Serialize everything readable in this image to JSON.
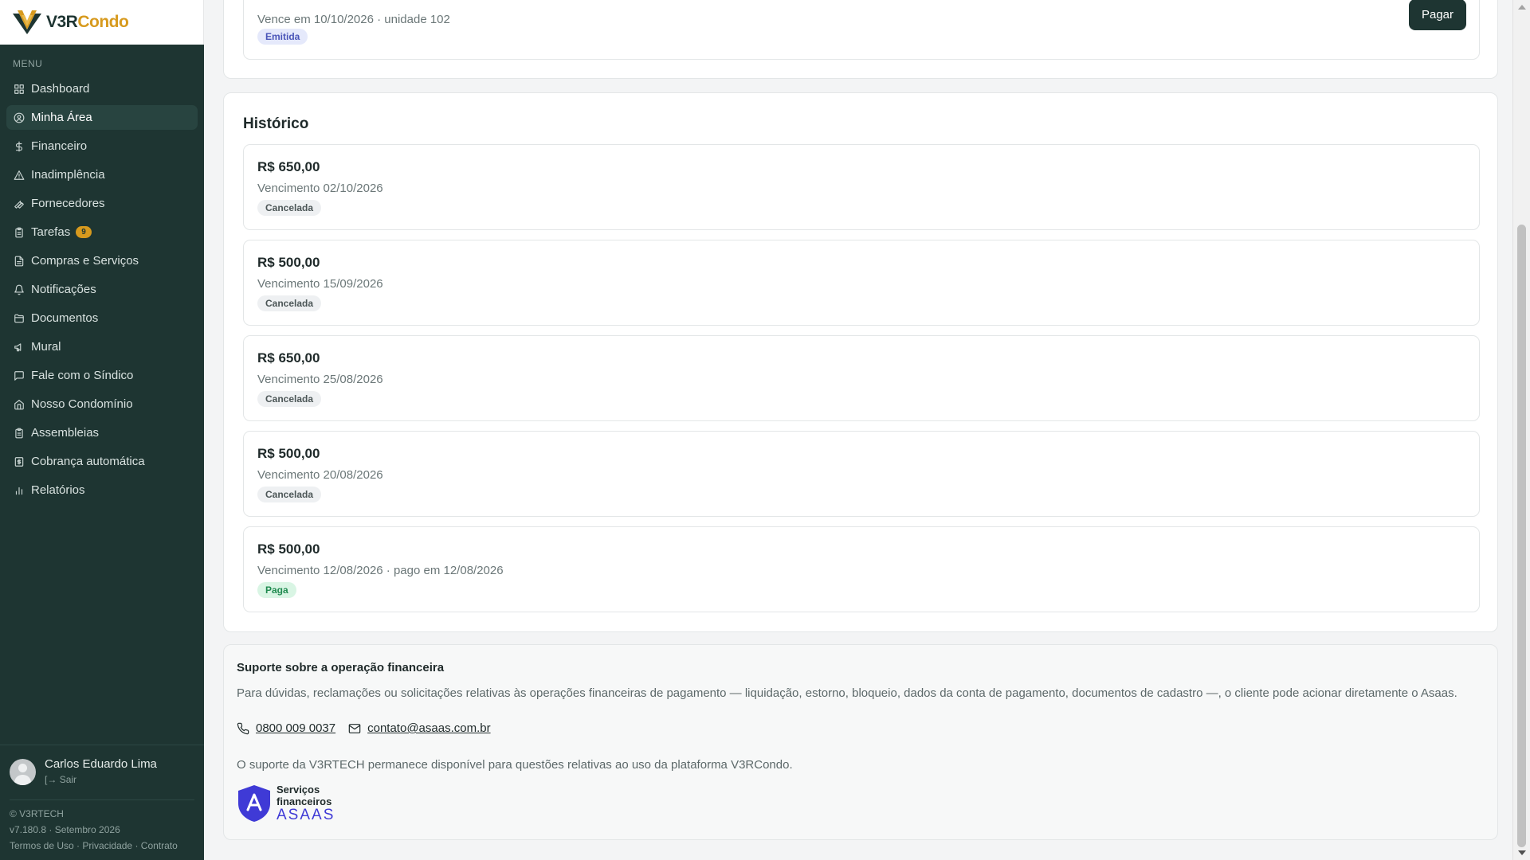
{
  "brand": {
    "name_part1": "V3R",
    "name_part2": "Condo",
    "accent_color": "#d79a1e",
    "sidebar_color": "#1e3532"
  },
  "sidebar": {
    "menu_heading": "MENU",
    "items": [
      {
        "label": "Dashboard",
        "icon": "grid-icon"
      },
      {
        "label": "Minha Área",
        "icon": "user-circle-icon",
        "active": true
      },
      {
        "label": "Financeiro",
        "icon": "dollar-icon"
      },
      {
        "label": "Inadimplência",
        "icon": "warning-triangle-icon"
      },
      {
        "label": "Fornecedores",
        "icon": "wrench-icon"
      },
      {
        "label": "Tarefas",
        "icon": "clipboard-icon",
        "badge": "9"
      },
      {
        "label": "Compras e Serviços",
        "icon": "document-icon"
      },
      {
        "label": "Notificações",
        "icon": "bell-icon"
      },
      {
        "label": "Documentos",
        "icon": "folder-icon"
      },
      {
        "label": "Mural",
        "icon": "megaphone-icon"
      },
      {
        "label": "Fale com o Síndico",
        "icon": "chat-icon"
      },
      {
        "label": "Nosso Condomínio",
        "icon": "home-icon"
      },
      {
        "label": "Assembleias",
        "icon": "clipboard-icon"
      },
      {
        "label": "Cobrança automática",
        "icon": "receipt-icon"
      },
      {
        "label": "Relatórios",
        "icon": "bar-chart-icon"
      }
    ],
    "user": {
      "name": "Carlos Eduardo Lima",
      "logout": "Sair"
    },
    "footer": {
      "copyright": "© V3RTECH",
      "version": "v7.180.8 · Setembro 2026",
      "links": [
        "Termos de Uso",
        "Privacidade",
        "Contrato"
      ]
    }
  },
  "current_invoice": {
    "due_line": "Vence em 10/10/2026 · unidade 102",
    "status": "Emitida",
    "pay_label": "Pagar"
  },
  "history": {
    "title": "Histórico",
    "items": [
      {
        "amount": "R$ 650,00",
        "due": "Vencimento 02/10/2026",
        "status": "Cancelada"
      },
      {
        "amount": "R$ 500,00",
        "due": "Vencimento 15/09/2026",
        "status": "Cancelada"
      },
      {
        "amount": "R$ 650,00",
        "due": "Vencimento 25/08/2026",
        "status": "Cancelada"
      },
      {
        "amount": "R$ 500,00",
        "due": "Vencimento 20/08/2026",
        "status": "Cancelada"
      },
      {
        "amount": "R$ 500,00",
        "due": "Vencimento 12/08/2026 · pago em 12/08/2026",
        "status": "Paga"
      }
    ]
  },
  "support": {
    "title": "Suporte sobre a operação financeira",
    "text": "Para dúvidas, reclamações ou solicitações relativas às operações financeiras de pagamento — liquidação, estorno, bloqueio, dados da conta de pagamento, documentos de cadastro —, o cliente pode acionar diretamente o Asaas.",
    "phone": "0800 009 0037",
    "email": "contato@asaas.com.br",
    "note": "O suporte da V3RTECH permanece disponível para questões relativas ao uso da plataforma V3RCondo.",
    "asaas_sub_line1": "Serviços",
    "asaas_sub_line2": "financeiros",
    "asaas_brand": "ASAAS"
  }
}
